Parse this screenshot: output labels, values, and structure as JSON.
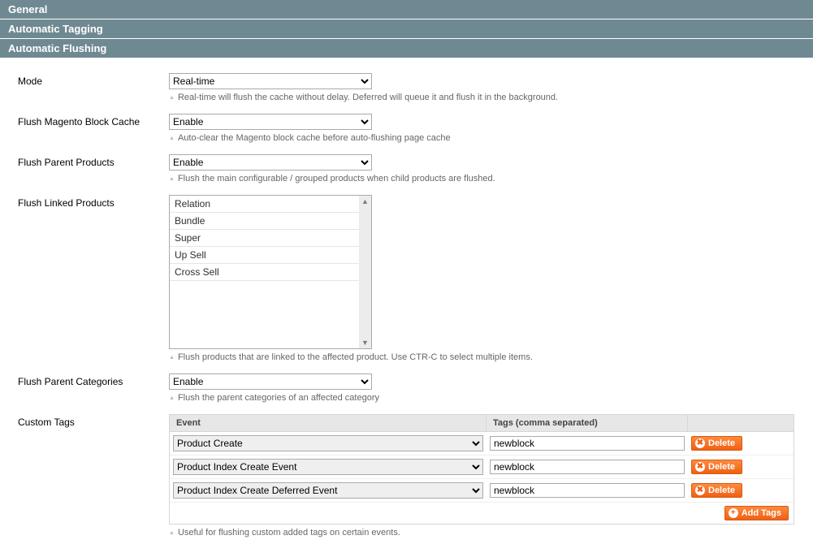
{
  "sections": {
    "general": "General",
    "tagging": "Automatic Tagging",
    "flushing": "Automatic Flushing"
  },
  "mode": {
    "label": "Mode",
    "value": "Real-time",
    "hint": "Real-time will flush the cache without delay. Deferred will queue it and flush it in the background."
  },
  "flush_block": {
    "label": "Flush Magento Block Cache",
    "value": "Enable",
    "hint": "Auto-clear the Magento block cache before auto-flushing page cache"
  },
  "flush_parent_products": {
    "label": "Flush Parent Products",
    "value": "Enable",
    "hint": "Flush the main configurable / grouped products when child products are flushed."
  },
  "flush_linked": {
    "label": "Flush Linked Products",
    "options": [
      "Relation",
      "Bundle",
      "Super",
      "Up Sell",
      "Cross Sell"
    ],
    "hint": "Flush products that are linked to the affected product. Use CTR-C to select multiple items."
  },
  "flush_parent_categories": {
    "label": "Flush Parent Categories",
    "value": "Enable",
    "hint": "Flush the parent categories of an affected category"
  },
  "custom_tags": {
    "label": "Custom Tags",
    "head_event": "Event",
    "head_tags": "Tags (comma separated)",
    "rows": [
      {
        "event": "Product Create",
        "tags": "newblock"
      },
      {
        "event": "Product Index Create Event",
        "tags": "newblock"
      },
      {
        "event": "Product Index Create Deferred Event",
        "tags": "newblock"
      }
    ],
    "delete_label": "Delete",
    "add_label": "Add Tags",
    "hint": "Useful for flushing custom added tags on certain events."
  }
}
